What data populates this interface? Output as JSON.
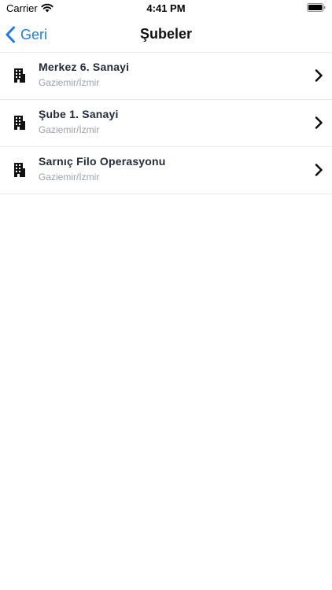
{
  "status_bar": {
    "carrier": "Carrier",
    "time": "4:41 PM",
    "wifi_icon": "wifi-icon",
    "battery_icon": "battery-icon"
  },
  "nav": {
    "back_label": "Geri",
    "back_icon": "chevron-left-icon",
    "title": "Şubeler",
    "accent_color": "#1a7cf5"
  },
  "branches": [
    {
      "name": "Merkez 6. Sanayi",
      "location": "Gaziemir/İzmir",
      "icon": "building-icon"
    },
    {
      "name": "Şube 1. Sanayi",
      "location": "Gaziemir/İzmir",
      "icon": "building-icon"
    },
    {
      "name": "Sarnıç Filo Operasyonu",
      "location": "Gaziemir/İzmir",
      "icon": "building-icon"
    }
  ]
}
